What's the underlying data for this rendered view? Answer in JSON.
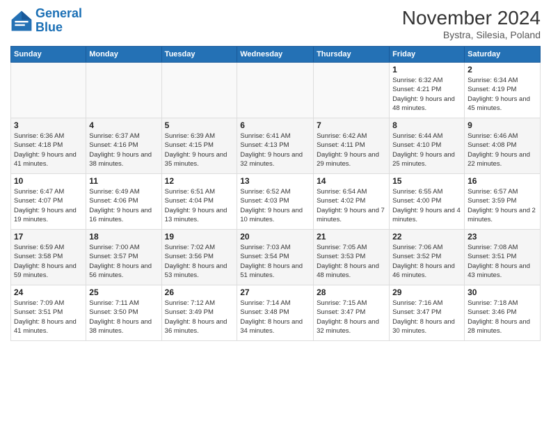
{
  "logo": {
    "line1": "General",
    "line2": "Blue"
  },
  "title": "November 2024",
  "subtitle": "Bystra, Silesia, Poland",
  "days_of_week": [
    "Sunday",
    "Monday",
    "Tuesday",
    "Wednesday",
    "Thursday",
    "Friday",
    "Saturday"
  ],
  "weeks": [
    [
      {
        "day": "",
        "sunrise": "",
        "sunset": "",
        "daylight": ""
      },
      {
        "day": "",
        "sunrise": "",
        "sunset": "",
        "daylight": ""
      },
      {
        "day": "",
        "sunrise": "",
        "sunset": "",
        "daylight": ""
      },
      {
        "day": "",
        "sunrise": "",
        "sunset": "",
        "daylight": ""
      },
      {
        "day": "",
        "sunrise": "",
        "sunset": "",
        "daylight": ""
      },
      {
        "day": "1",
        "sunrise": "Sunrise: 6:32 AM",
        "sunset": "Sunset: 4:21 PM",
        "daylight": "Daylight: 9 hours and 48 minutes."
      },
      {
        "day": "2",
        "sunrise": "Sunrise: 6:34 AM",
        "sunset": "Sunset: 4:19 PM",
        "daylight": "Daylight: 9 hours and 45 minutes."
      }
    ],
    [
      {
        "day": "3",
        "sunrise": "Sunrise: 6:36 AM",
        "sunset": "Sunset: 4:18 PM",
        "daylight": "Daylight: 9 hours and 41 minutes."
      },
      {
        "day": "4",
        "sunrise": "Sunrise: 6:37 AM",
        "sunset": "Sunset: 4:16 PM",
        "daylight": "Daylight: 9 hours and 38 minutes."
      },
      {
        "day": "5",
        "sunrise": "Sunrise: 6:39 AM",
        "sunset": "Sunset: 4:15 PM",
        "daylight": "Daylight: 9 hours and 35 minutes."
      },
      {
        "day": "6",
        "sunrise": "Sunrise: 6:41 AM",
        "sunset": "Sunset: 4:13 PM",
        "daylight": "Daylight: 9 hours and 32 minutes."
      },
      {
        "day": "7",
        "sunrise": "Sunrise: 6:42 AM",
        "sunset": "Sunset: 4:11 PM",
        "daylight": "Daylight: 9 hours and 29 minutes."
      },
      {
        "day": "8",
        "sunrise": "Sunrise: 6:44 AM",
        "sunset": "Sunset: 4:10 PM",
        "daylight": "Daylight: 9 hours and 25 minutes."
      },
      {
        "day": "9",
        "sunrise": "Sunrise: 6:46 AM",
        "sunset": "Sunset: 4:08 PM",
        "daylight": "Daylight: 9 hours and 22 minutes."
      }
    ],
    [
      {
        "day": "10",
        "sunrise": "Sunrise: 6:47 AM",
        "sunset": "Sunset: 4:07 PM",
        "daylight": "Daylight: 9 hours and 19 minutes."
      },
      {
        "day": "11",
        "sunrise": "Sunrise: 6:49 AM",
        "sunset": "Sunset: 4:06 PM",
        "daylight": "Daylight: 9 hours and 16 minutes."
      },
      {
        "day": "12",
        "sunrise": "Sunrise: 6:51 AM",
        "sunset": "Sunset: 4:04 PM",
        "daylight": "Daylight: 9 hours and 13 minutes."
      },
      {
        "day": "13",
        "sunrise": "Sunrise: 6:52 AM",
        "sunset": "Sunset: 4:03 PM",
        "daylight": "Daylight: 9 hours and 10 minutes."
      },
      {
        "day": "14",
        "sunrise": "Sunrise: 6:54 AM",
        "sunset": "Sunset: 4:02 PM",
        "daylight": "Daylight: 9 hours and 7 minutes."
      },
      {
        "day": "15",
        "sunrise": "Sunrise: 6:55 AM",
        "sunset": "Sunset: 4:00 PM",
        "daylight": "Daylight: 9 hours and 4 minutes."
      },
      {
        "day": "16",
        "sunrise": "Sunrise: 6:57 AM",
        "sunset": "Sunset: 3:59 PM",
        "daylight": "Daylight: 9 hours and 2 minutes."
      }
    ],
    [
      {
        "day": "17",
        "sunrise": "Sunrise: 6:59 AM",
        "sunset": "Sunset: 3:58 PM",
        "daylight": "Daylight: 8 hours and 59 minutes."
      },
      {
        "day": "18",
        "sunrise": "Sunrise: 7:00 AM",
        "sunset": "Sunset: 3:57 PM",
        "daylight": "Daylight: 8 hours and 56 minutes."
      },
      {
        "day": "19",
        "sunrise": "Sunrise: 7:02 AM",
        "sunset": "Sunset: 3:56 PM",
        "daylight": "Daylight: 8 hours and 53 minutes."
      },
      {
        "day": "20",
        "sunrise": "Sunrise: 7:03 AM",
        "sunset": "Sunset: 3:54 PM",
        "daylight": "Daylight: 8 hours and 51 minutes."
      },
      {
        "day": "21",
        "sunrise": "Sunrise: 7:05 AM",
        "sunset": "Sunset: 3:53 PM",
        "daylight": "Daylight: 8 hours and 48 minutes."
      },
      {
        "day": "22",
        "sunrise": "Sunrise: 7:06 AM",
        "sunset": "Sunset: 3:52 PM",
        "daylight": "Daylight: 8 hours and 46 minutes."
      },
      {
        "day": "23",
        "sunrise": "Sunrise: 7:08 AM",
        "sunset": "Sunset: 3:51 PM",
        "daylight": "Daylight: 8 hours and 43 minutes."
      }
    ],
    [
      {
        "day": "24",
        "sunrise": "Sunrise: 7:09 AM",
        "sunset": "Sunset: 3:51 PM",
        "daylight": "Daylight: 8 hours and 41 minutes."
      },
      {
        "day": "25",
        "sunrise": "Sunrise: 7:11 AM",
        "sunset": "Sunset: 3:50 PM",
        "daylight": "Daylight: 8 hours and 38 minutes."
      },
      {
        "day": "26",
        "sunrise": "Sunrise: 7:12 AM",
        "sunset": "Sunset: 3:49 PM",
        "daylight": "Daylight: 8 hours and 36 minutes."
      },
      {
        "day": "27",
        "sunrise": "Sunrise: 7:14 AM",
        "sunset": "Sunset: 3:48 PM",
        "daylight": "Daylight: 8 hours and 34 minutes."
      },
      {
        "day": "28",
        "sunrise": "Sunrise: 7:15 AM",
        "sunset": "Sunset: 3:47 PM",
        "daylight": "Daylight: 8 hours and 32 minutes."
      },
      {
        "day": "29",
        "sunrise": "Sunrise: 7:16 AM",
        "sunset": "Sunset: 3:47 PM",
        "daylight": "Daylight: 8 hours and 30 minutes."
      },
      {
        "day": "30",
        "sunrise": "Sunrise: 7:18 AM",
        "sunset": "Sunset: 3:46 PM",
        "daylight": "Daylight: 8 hours and 28 minutes."
      }
    ]
  ]
}
